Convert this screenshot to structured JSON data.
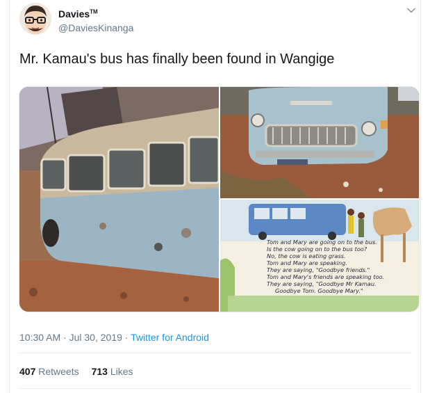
{
  "user": {
    "name": "Davies",
    "trademark": "TM",
    "handle": "@DaviesKinanga"
  },
  "tweet": {
    "text": "Mr. Kamau's bus has finally been found in Wangige"
  },
  "book_page": {
    "lines": [
      "Tom and Mary are going on to the bus.",
      "Is the cow going on to the bus too?",
      "No, the cow is eating grass.",
      "Tom and Mary are speaking.",
      "They are saying, \"Goodbye friends.\"",
      "Tom and Mary's friends are speaking too.",
      "They are saying, \"Goodbye Mr Kamau.",
      "Goodbye Tom. Goodbye Mary.\""
    ]
  },
  "meta": {
    "time": "10:30 AM",
    "dot1": " · ",
    "date": "Jul 30, 2019",
    "dot2": " · ",
    "source": "Twitter for Android"
  },
  "stats": {
    "retweets_count": "407",
    "retweets_label": "Retweets",
    "likes_count": "713",
    "likes_label": "Likes"
  },
  "icons": {
    "more": "chevron-down-icon",
    "avatar": "avatar"
  }
}
